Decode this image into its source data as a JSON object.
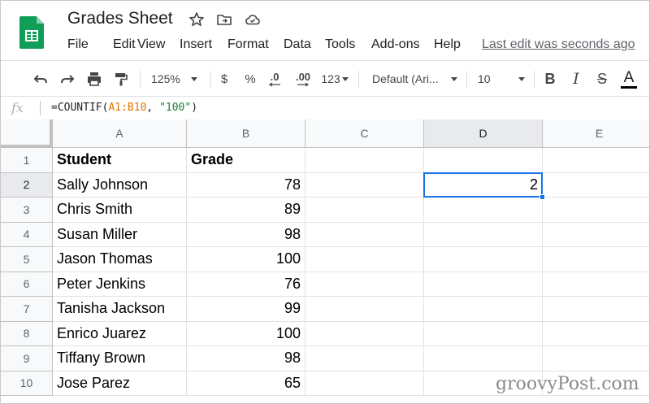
{
  "app": {
    "doc_title": "Grades Sheet",
    "last_edit": "Last edit was seconds ago"
  },
  "menu": [
    "File",
    "Edit",
    "View",
    "Insert",
    "Format",
    "Data",
    "Tools",
    "Add-ons",
    "Help"
  ],
  "toolbar": {
    "zoom": "125%",
    "currency": "$",
    "percent": "%",
    "decrease_decimal": ".0",
    "increase_decimal": ".00",
    "more_formats": "123",
    "font": "Default (Ari...",
    "font_size": "10",
    "bold": "B",
    "italic": "I",
    "strikethrough": "S",
    "text_color": "A",
    "text_color_value": "#000000"
  },
  "formula_bar": {
    "fx": "fx",
    "prefix": "=COUNTIF(",
    "range": "A1:B10",
    "sep": ", ",
    "criterion": "\"100\"",
    "suffix": ")"
  },
  "columns": [
    "A",
    "B",
    "C",
    "D",
    "E"
  ],
  "rows": [
    "1",
    "2",
    "3",
    "4",
    "5",
    "6",
    "7",
    "8",
    "9",
    "10"
  ],
  "headers": {
    "student": "Student",
    "grade": "Grade"
  },
  "students": [
    {
      "name": "Sally Johnson",
      "grade": "78"
    },
    {
      "name": "Chris Smith",
      "grade": "89"
    },
    {
      "name": "Susan Miller",
      "grade": "98"
    },
    {
      "name": "Jason Thomas",
      "grade": "100"
    },
    {
      "name": "Peter Jenkins",
      "grade": "76"
    },
    {
      "name": "Tanisha Jackson",
      "grade": "99"
    },
    {
      "name": "Enrico Juarez",
      "grade": "100"
    },
    {
      "name": "Tiffany Brown",
      "grade": "98"
    },
    {
      "name": "Jose Parez",
      "grade": "65"
    }
  ],
  "selected_cell": {
    "ref": "D2",
    "value": "2"
  },
  "watermark": "groovyPost.com",
  "colors": {
    "accent": "#1a73e8",
    "logo": "#0f9d58",
    "formula_range": "#e37400",
    "formula_string": "#188038"
  }
}
